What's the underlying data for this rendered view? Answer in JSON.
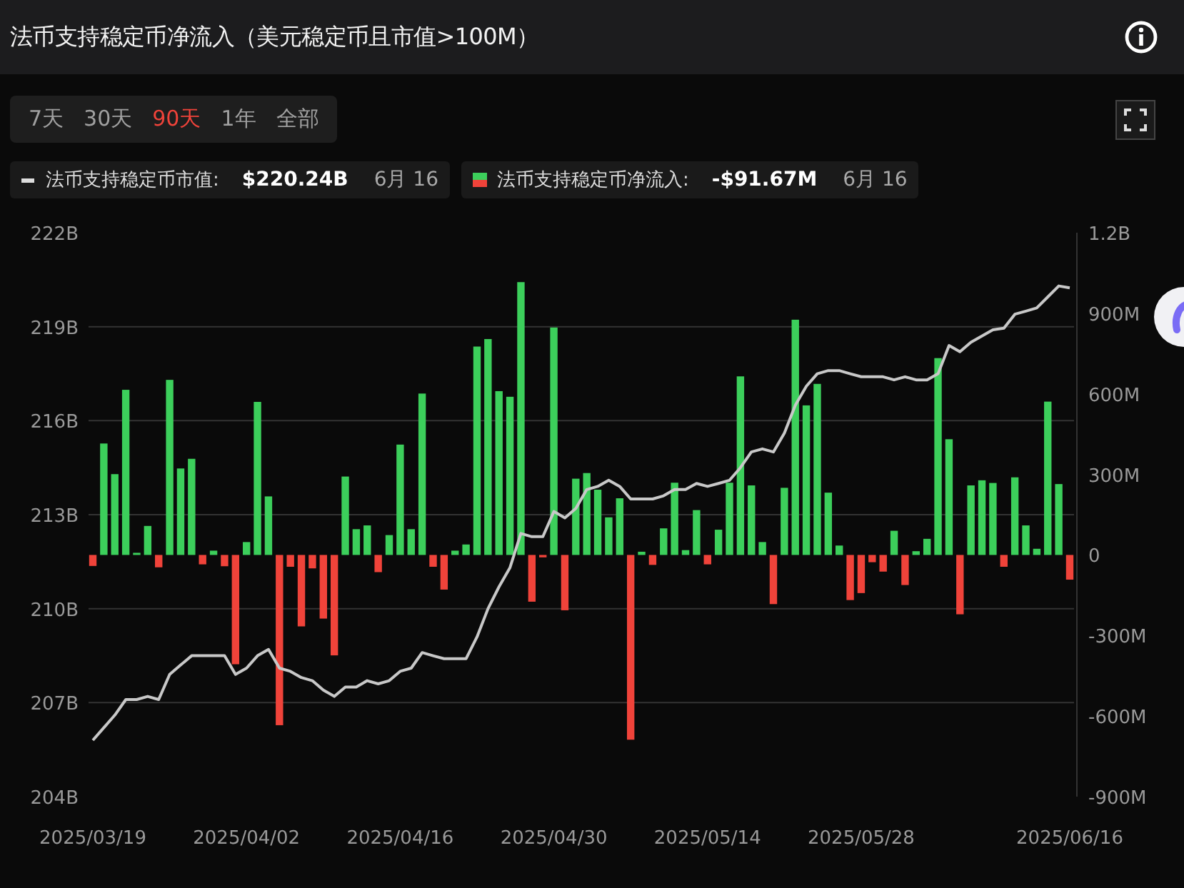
{
  "header": {
    "title": "法币支持稳定币净流入（美元稳定币且市值>100M）"
  },
  "range_tabs": [
    {
      "label": "7天",
      "selected": false
    },
    {
      "label": "30天",
      "selected": false
    },
    {
      "label": "90天",
      "selected": true
    },
    {
      "label": "1年",
      "selected": false
    },
    {
      "label": "全部",
      "selected": false
    }
  ],
  "legend": [
    {
      "kind": "line",
      "label": "法币支持稳定币市值:",
      "value": "$220.24B",
      "date": "6月 16"
    },
    {
      "kind": "bar",
      "label": "法币支持稳定币净流入:",
      "value": "-$91.67M",
      "date": "6月 16"
    }
  ],
  "chart": {
    "chart_data": {
      "type": "bar",
      "grid": true,
      "categories": [
        "2025/03/19",
        null,
        null,
        null,
        null,
        null,
        null,
        null,
        null,
        null,
        null,
        null,
        null,
        null,
        "2025/04/02",
        null,
        null,
        null,
        null,
        null,
        null,
        null,
        null,
        null,
        null,
        null,
        null,
        null,
        "2025/04/16",
        null,
        null,
        null,
        null,
        null,
        null,
        null,
        null,
        null,
        null,
        null,
        null,
        null,
        "2025/04/30",
        null,
        null,
        null,
        null,
        null,
        null,
        null,
        null,
        null,
        null,
        null,
        null,
        null,
        "2025/05/14",
        null,
        null,
        null,
        null,
        null,
        null,
        null,
        null,
        null,
        null,
        null,
        null,
        null,
        "2025/05/28",
        null,
        null,
        null,
        null,
        null,
        null,
        null,
        null,
        null,
        null,
        null,
        null,
        null,
        null,
        null,
        null,
        null,
        null,
        "2025/06/16"
      ],
      "ylim": [
        204,
        222
      ],
      "yticks": [
        {
          "value": 222,
          "label": "222B"
        },
        {
          "value": 219,
          "label": "219B"
        },
        {
          "value": 216,
          "label": "216B"
        },
        {
          "value": 213,
          "label": "213B"
        },
        {
          "value": 210,
          "label": "210B"
        },
        {
          "value": 207,
          "label": "207B"
        },
        {
          "value": 204,
          "label": "204B"
        }
      ],
      "y2lim": [
        -900000000,
        1200000000
      ],
      "y2ticks": [
        {
          "value": 1200000000,
          "label": "1.2B"
        },
        {
          "value": 900000000,
          "label": "900M"
        },
        {
          "value": 600000000,
          "label": "600M"
        },
        {
          "value": 300000000,
          "label": "300M"
        },
        {
          "value": 0,
          "label": "0"
        },
        {
          "value": -300000000,
          "label": "-300M"
        },
        {
          "value": -600000000,
          "label": "-600M"
        },
        {
          "value": -900000000,
          "label": "-900M"
        }
      ],
      "series": [
        {
          "axis": "y2",
          "color": "#3ccf5b",
          "values": [
            null,
            415000000.0,
            301000000.0,
            615000000.0,
            7000000.0,
            108000000.0,
            null,
            652000000.0,
            322000000.0,
            358000000.0,
            null,
            16000000.0,
            null,
            null,
            48000000.0,
            570000000.0,
            218000000.0,
            null,
            null,
            null,
            null,
            null,
            null,
            292000000.0,
            96000000.0,
            110000000.0,
            null,
            74000000.0,
            411000000.0,
            96000000.0,
            601000000.0,
            null,
            null,
            16000000.0,
            39000000.0,
            776000000.0,
            804000000.0,
            610000000.0,
            589000000.0,
            1016000000.0,
            null,
            null,
            847000000.0,
            null,
            284000000.0,
            305000000.0,
            243000000.0,
            140000000.0,
            211000000.0,
            null,
            12000000.0,
            null,
            99000000.0,
            269000000.0,
            18000000.0,
            167000000.0,
            null,
            94000000.0,
            269000000.0,
            665000000.0,
            259000000.0,
            48000000.0,
            null,
            250000000.0,
            876000000.0,
            557000000.0,
            637000000.0,
            232000000.0,
            35000000.0,
            null,
            null,
            null,
            null,
            90000000.0,
            null,
            14000000.0,
            60000000.0,
            733000000.0,
            431000000.0,
            null,
            259000000.0,
            278000000.0,
            268000000.0,
            null,
            289000000.0,
            110000000.0,
            23000000.0,
            571000000.0,
            264000000.0,
            null
          ]
        },
        {
          "axis": "y2",
          "color": "#f0433a",
          "values": [
            -41000000.0,
            null,
            null,
            null,
            null,
            null,
            -46000000.0,
            null,
            null,
            null,
            -35000000.0,
            null,
            -42000000.0,
            -407000000.0,
            null,
            null,
            null,
            -634000000.0,
            -44000000.0,
            -266000000.0,
            -50000000.0,
            -237000000.0,
            -374000000.0,
            null,
            null,
            null,
            -64000000.0,
            null,
            null,
            null,
            null,
            -44000000.0,
            -129000000.0,
            null,
            null,
            null,
            null,
            null,
            null,
            null,
            -174000000.0,
            -9000000.0,
            null,
            -206000000.0,
            null,
            null,
            null,
            null,
            null,
            -688000000.0,
            null,
            -37000000.0,
            null,
            null,
            null,
            null,
            -35000000.0,
            null,
            null,
            null,
            null,
            null,
            -183000000.0,
            null,
            null,
            null,
            null,
            null,
            null,
            -168000000.0,
            -142000000.0,
            -27000000.0,
            -62000000.0,
            null,
            -112000000.0,
            null,
            null,
            null,
            null,
            -221000000.0,
            null,
            null,
            null,
            -44000000.0,
            null,
            null,
            null,
            null,
            null,
            -92000000.0
          ]
        },
        {
          "type": "line",
          "color": "#c8c8c8",
          "values": [
            205.8,
            206.2,
            206.6,
            207.1,
            207.1,
            207.2,
            207.1,
            207.9,
            208.2,
            208.5,
            208.5,
            208.5,
            208.5,
            207.9,
            208.1,
            208.5,
            208.7,
            208.1,
            208.0,
            207.8,
            207.7,
            207.4,
            207.2,
            207.5,
            207.5,
            207.7,
            207.6,
            207.7,
            208.0,
            208.1,
            208.6,
            208.5,
            208.4,
            208.4,
            208.4,
            209.1,
            210.0,
            210.7,
            211.3,
            212.4,
            212.3,
            212.3,
            213.1,
            212.9,
            213.2,
            213.8,
            213.9,
            214.1,
            213.9,
            213.5,
            213.5,
            213.5,
            213.6,
            213.8,
            213.8,
            214.0,
            213.9,
            214.0,
            214.1,
            214.5,
            215.0,
            215.1,
            215.0,
            215.6,
            216.5,
            217.1,
            217.5,
            217.6,
            217.6,
            217.5,
            217.4,
            217.4,
            217.4,
            217.3,
            217.4,
            217.3,
            217.3,
            217.5,
            218.4,
            218.2,
            218.5,
            218.7,
            218.9,
            218.95,
            219.4,
            219.5,
            219.6,
            219.95,
            220.3,
            220.24
          ]
        }
      ]
    }
  }
}
